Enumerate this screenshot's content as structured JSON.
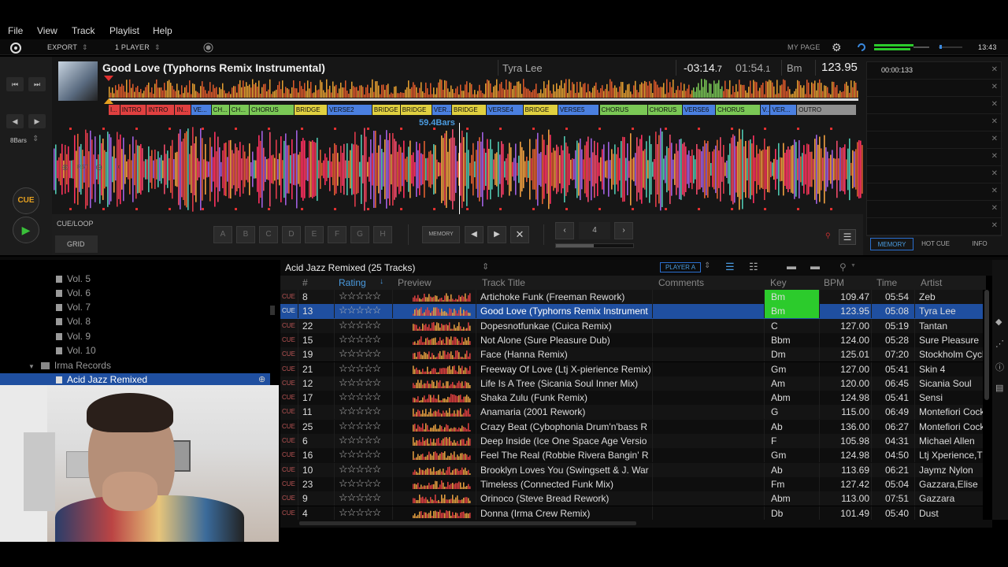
{
  "menu": [
    "File",
    "View",
    "Track",
    "Playlist",
    "Help"
  ],
  "toolbar": {
    "export": "EXPORT",
    "player_mode": "1 PLAYER",
    "my_page": "MY PAGE",
    "clock": "13:43"
  },
  "deck": {
    "title": "Good Love (Typhorns Remix Instrumental)",
    "artist": "Tyra Lee",
    "remain_main": "-03:14",
    "remain_frac": ".7",
    "elapsed_main": "01:54",
    "elapsed_frac": ".1",
    "key": "Bm",
    "bpm": "123.95",
    "bars_label": "59.4Bars",
    "beat_jump": "8Bars",
    "cue": "CUE",
    "cue_loop": "CUE/LOOP",
    "grid": "GRID",
    "memory": "MEMORY",
    "loop_beats": "4",
    "hot_cues": [
      "A",
      "B",
      "C",
      "D",
      "E",
      "F",
      "G",
      "H"
    ],
    "rst": "RST",
    "phrases": [
      {
        "label": "I...",
        "color": "#e04040"
      },
      {
        "label": "INTRO",
        "color": "#e04040"
      },
      {
        "label": "INTRO",
        "color": "#e04040"
      },
      {
        "label": "IN...",
        "color": "#e04040"
      },
      {
        "label": "VE...",
        "color": "#4a7fe0"
      },
      {
        "label": "CH...",
        "color": "#7ac855"
      },
      {
        "label": "CH...",
        "color": "#7ac855"
      },
      {
        "label": "CHORUS",
        "color": "#7ac855"
      },
      {
        "label": "BRIDGE",
        "color": "#e0d040"
      },
      {
        "label": "VERSE2",
        "color": "#4a7fe0"
      },
      {
        "label": "BRIDGE",
        "color": "#e0d040"
      },
      {
        "label": "BRIDGE",
        "color": "#e0d040"
      },
      {
        "label": "VER...",
        "color": "#4a7fe0"
      },
      {
        "label": "BRIDGE",
        "color": "#e0d040"
      },
      {
        "label": "VERSE4",
        "color": "#4a7fe0"
      },
      {
        "label": "BRIDGE",
        "color": "#e0d040"
      },
      {
        "label": "VERSE5",
        "color": "#4a7fe0"
      },
      {
        "label": "CHORUS",
        "color": "#7ac855"
      },
      {
        "label": "CHORUS",
        "color": "#7ac855"
      },
      {
        "label": "VERSE6",
        "color": "#4a7fe0"
      },
      {
        "label": "CHORUS",
        "color": "#7ac855"
      },
      {
        "label": "V...",
        "color": "#4a7fe0"
      },
      {
        "label": "VER...",
        "color": "#4a7fe0"
      },
      {
        "label": "OUTRO",
        "color": "#909090"
      }
    ]
  },
  "cue_panel": {
    "first_time": "00:00:133",
    "tabs": [
      "MEMORY",
      "HOT CUE",
      "INFO"
    ]
  },
  "tree": {
    "items": [
      "Vol. 5",
      "Vol. 6",
      "Vol. 7",
      "Vol. 8",
      "Vol. 9",
      "Vol. 10"
    ],
    "folder": "Irma Records",
    "selected": "Acid Jazz Remixed"
  },
  "playlist": {
    "title": "Acid Jazz Remixed (25 Tracks)",
    "player": "PLAYER A",
    "columns": [
      "#",
      "Rating",
      "Preview",
      "Track Title",
      "Comments",
      "Key",
      "BPM",
      "Time",
      "Artist"
    ],
    "row_tag": "CUE",
    "rows": [
      {
        "num": "8",
        "title": "Artichoke Funk (Freeman Rework)",
        "key": "Bm",
        "bpm": "109.47",
        "time": "05:54",
        "artist": "Zeb"
      },
      {
        "num": "13",
        "title": "Good Love (Typhorns Remix Instrument",
        "key": "Bm",
        "bpm": "123.95",
        "time": "05:08",
        "artist": "Tyra Lee"
      },
      {
        "num": "22",
        "title": "Dopesnotfunkae (Cuica Remix)",
        "key": "C",
        "bpm": "127.00",
        "time": "05:19",
        "artist": "Tantan"
      },
      {
        "num": "15",
        "title": "Not Alone (Sure Pleasure Dub)",
        "key": "Bbm",
        "bpm": "124.00",
        "time": "05:28",
        "artist": "Sure Pleasure"
      },
      {
        "num": "19",
        "title": "Face (Hanna Remix)",
        "key": "Dm",
        "bpm": "125.01",
        "time": "07:20",
        "artist": "Stockholm Cycl"
      },
      {
        "num": "21",
        "title": "Freeway Of Love (Ltj X-pierience Remix)",
        "key": "Gm",
        "bpm": "127.00",
        "time": "05:41",
        "artist": "Skin 4"
      },
      {
        "num": "12",
        "title": "Life Is A Tree (Sicania Soul Inner Mix)",
        "key": "Am",
        "bpm": "120.00",
        "time": "06:45",
        "artist": "Sicania Soul"
      },
      {
        "num": "17",
        "title": "Shaka Zulu (Funk Remix)",
        "key": "Abm",
        "bpm": "124.98",
        "time": "05:41",
        "artist": "Sensi"
      },
      {
        "num": "11",
        "title": "Anamaria (2001 Rework)",
        "key": "G",
        "bpm": "115.00",
        "time": "06:49",
        "artist": "Montefiori Cock"
      },
      {
        "num": "25",
        "title": "Crazy Beat (Cybophonia Drum'n'bass R",
        "key": "Ab",
        "bpm": "136.00",
        "time": "06:27",
        "artist": "Montefiori Cock"
      },
      {
        "num": "6",
        "title": "Deep Inside (Ice One Space Age Versio",
        "key": "F",
        "bpm": "105.98",
        "time": "04:31",
        "artist": "Michael Allen"
      },
      {
        "num": "16",
        "title": "Feel The Real (Robbie Rivera Bangin' R",
        "key": "Gm",
        "bpm": "124.98",
        "time": "04:50",
        "artist": "Ltj Xperience,T"
      },
      {
        "num": "10",
        "title": "Brooklyn Loves You (Swingsett & J. War",
        "key": "Ab",
        "bpm": "113.69",
        "time": "06:21",
        "artist": "Jaymz Nylon"
      },
      {
        "num": "23",
        "title": "Timeless (Connected Funk Mix)",
        "key": "Fm",
        "bpm": "127.42",
        "time": "05:04",
        "artist": "Gazzara,Elise"
      },
      {
        "num": "9",
        "title": "Orinoco (Steve Bread Rework)",
        "key": "Abm",
        "bpm": "113.00",
        "time": "07:51",
        "artist": "Gazzara"
      },
      {
        "num": "4",
        "title": "Donna (Irma Crew Remix)",
        "key": "Db",
        "bpm": "101.49",
        "time": "05:40",
        "artist": "Dust"
      }
    ],
    "stars": "☆☆☆☆☆"
  },
  "colors": {
    "accent_blue": "#1f4fa0",
    "key_green": "#2ccb2c",
    "cue_orange": "#e5a020",
    "play_green": "#3ac03a"
  }
}
